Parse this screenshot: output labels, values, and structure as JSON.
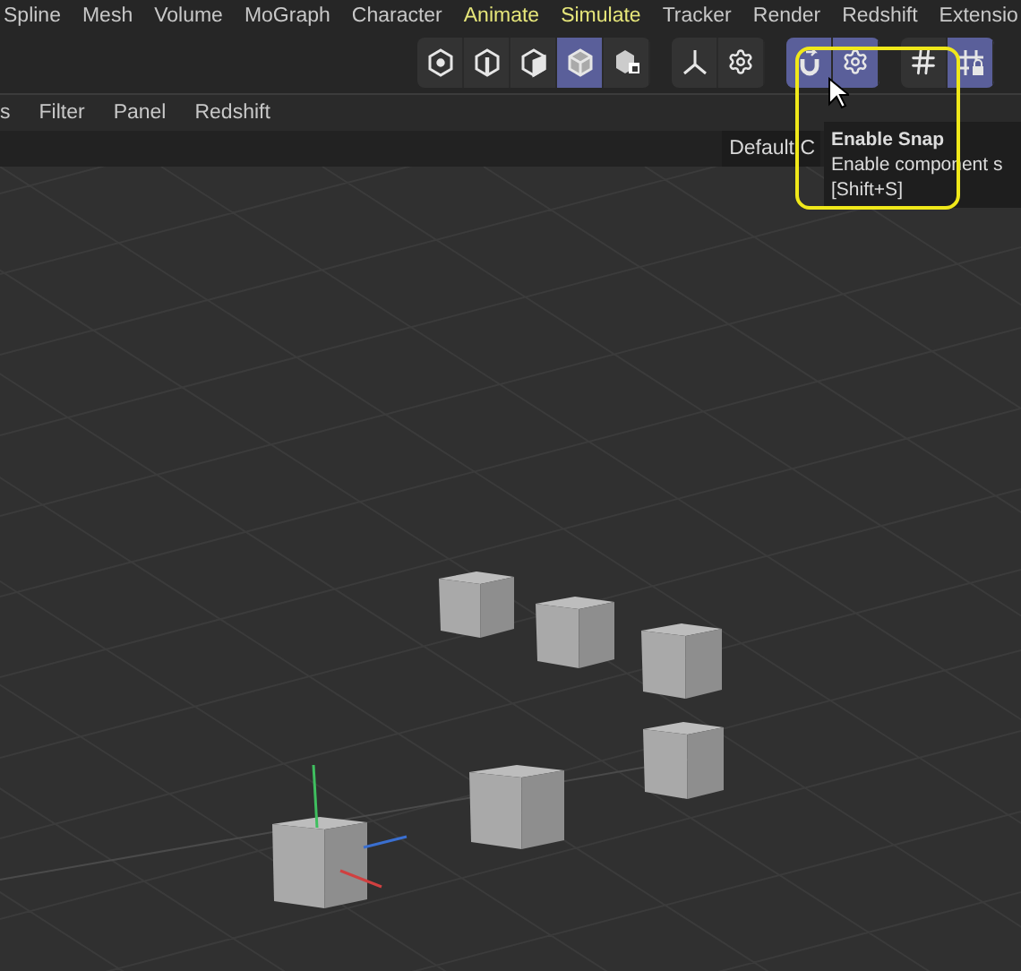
{
  "menu_bar": [
    {
      "label": "Spline",
      "color": "#c8c8c8"
    },
    {
      "label": "Mesh",
      "color": "#c8c8c8"
    },
    {
      "label": "Volume",
      "color": "#c8c8c8"
    },
    {
      "label": "MoGraph",
      "color": "#c8c8c8"
    },
    {
      "label": "Character",
      "color": "#c8c8c8"
    },
    {
      "label": "Animate",
      "color": "#e6e67a"
    },
    {
      "label": "Simulate",
      "color": "#e6e67a"
    },
    {
      "label": "Tracker",
      "color": "#c8c8c8"
    },
    {
      "label": "Render",
      "color": "#c8c8c8"
    },
    {
      "label": "Redshift",
      "color": "#c8c8c8"
    },
    {
      "label": "Extensio",
      "color": "#c8c8c8"
    }
  ],
  "toolbar": [
    {
      "buttons": [
        {
          "kind": "points",
          "selected": false
        },
        {
          "kind": "edges",
          "selected": false
        },
        {
          "kind": "polygons",
          "selected": false
        },
        {
          "kind": "model",
          "selected": true
        },
        {
          "kind": "texture",
          "selected": false
        }
      ]
    },
    {
      "buttons": [
        {
          "kind": "axis",
          "selected": false
        },
        {
          "kind": "settings",
          "selected": false
        }
      ]
    },
    {
      "buttons": [
        {
          "kind": "snap",
          "selected": true
        },
        {
          "kind": "settings",
          "selected": true
        }
      ]
    },
    {
      "buttons": [
        {
          "kind": "grid",
          "selected": false
        },
        {
          "kind": "grid-lock",
          "selected": true
        }
      ]
    }
  ],
  "viewport_menu": [
    "s",
    "Filter",
    "Panel",
    "Redshift"
  ],
  "camera_label": "Default C",
  "tooltip": {
    "title": "Enable Snap",
    "text": "Enable component s",
    "shortcut": "[Shift+S]"
  }
}
